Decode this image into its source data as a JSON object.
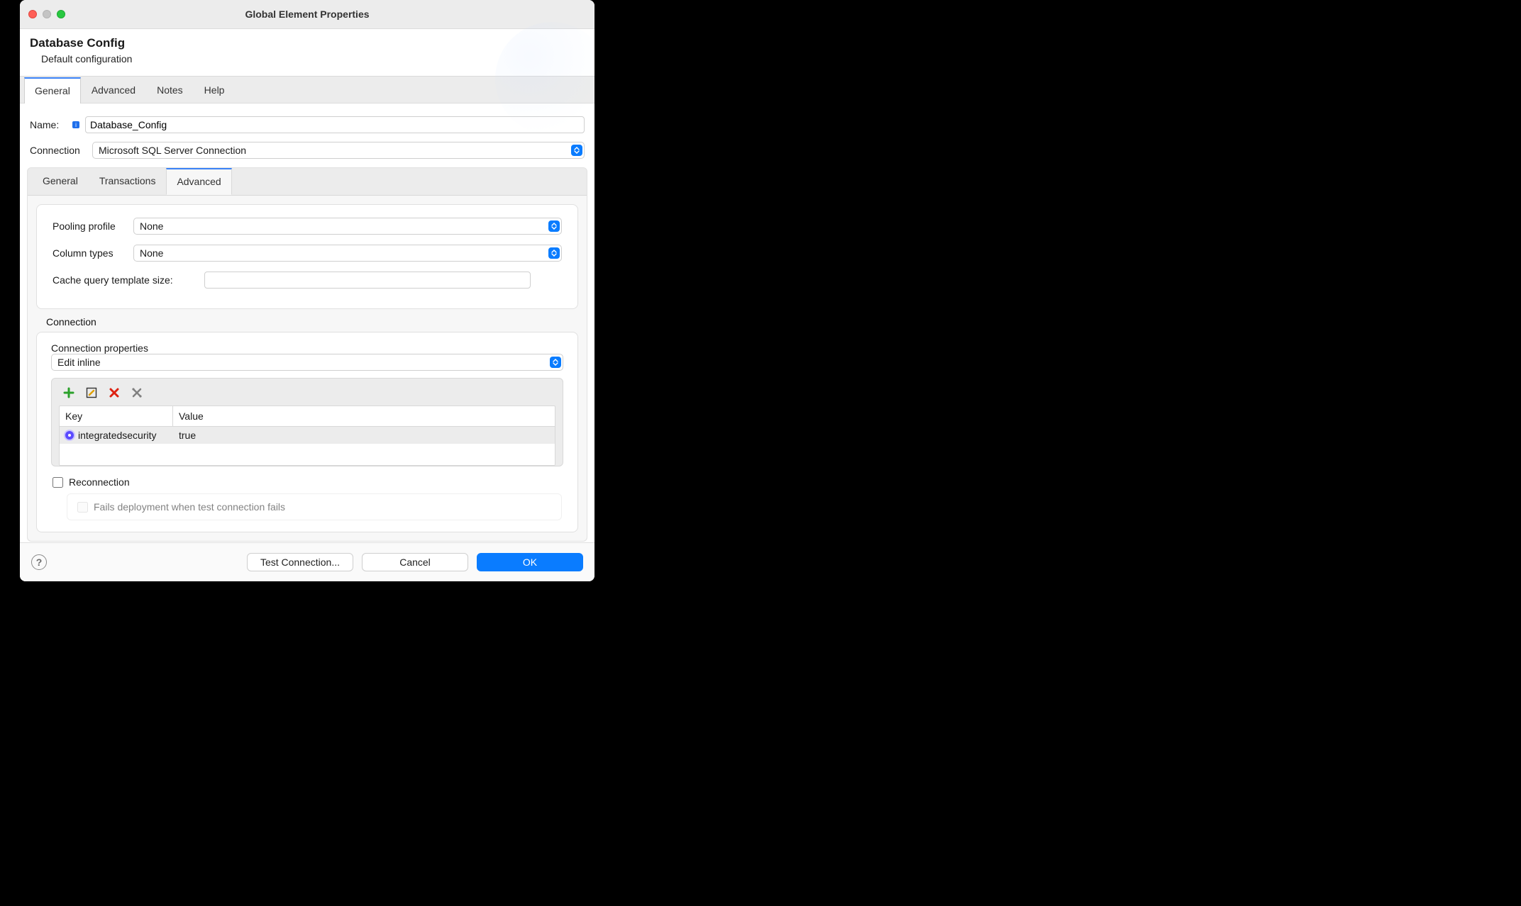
{
  "window": {
    "title": "Global Element Properties"
  },
  "header": {
    "title": "Database Config",
    "subtitle": "Default configuration"
  },
  "outer_tabs": {
    "items": [
      "General",
      "Advanced",
      "Notes",
      "Help"
    ],
    "active_index": 0
  },
  "form": {
    "name_label": "Name:",
    "name_value": "Database_Config",
    "connection_label": "Connection",
    "connection_value": "Microsoft SQL Server Connection"
  },
  "inner_tabs": {
    "items": [
      "General",
      "Transactions",
      "Advanced"
    ],
    "active_index": 2
  },
  "advanced": {
    "pooling_label": "Pooling profile",
    "pooling_value": "None",
    "column_types_label": "Column types",
    "column_types_value": "None",
    "cache_label": "Cache query template size:",
    "cache_value": ""
  },
  "connection_section": {
    "heading": "Connection",
    "props_label": "Connection properties",
    "props_value": "Edit inline",
    "table": {
      "col_key": "Key",
      "col_value": "Value",
      "rows": [
        {
          "key": "integratedsecurity",
          "value": "true"
        }
      ]
    },
    "reconnection_label": "Reconnection",
    "reconnection_checked": false,
    "fails_label": "Fails deployment when test connection fails",
    "fails_checked": false
  },
  "footer": {
    "test": "Test Connection...",
    "cancel": "Cancel",
    "ok": "OK"
  }
}
